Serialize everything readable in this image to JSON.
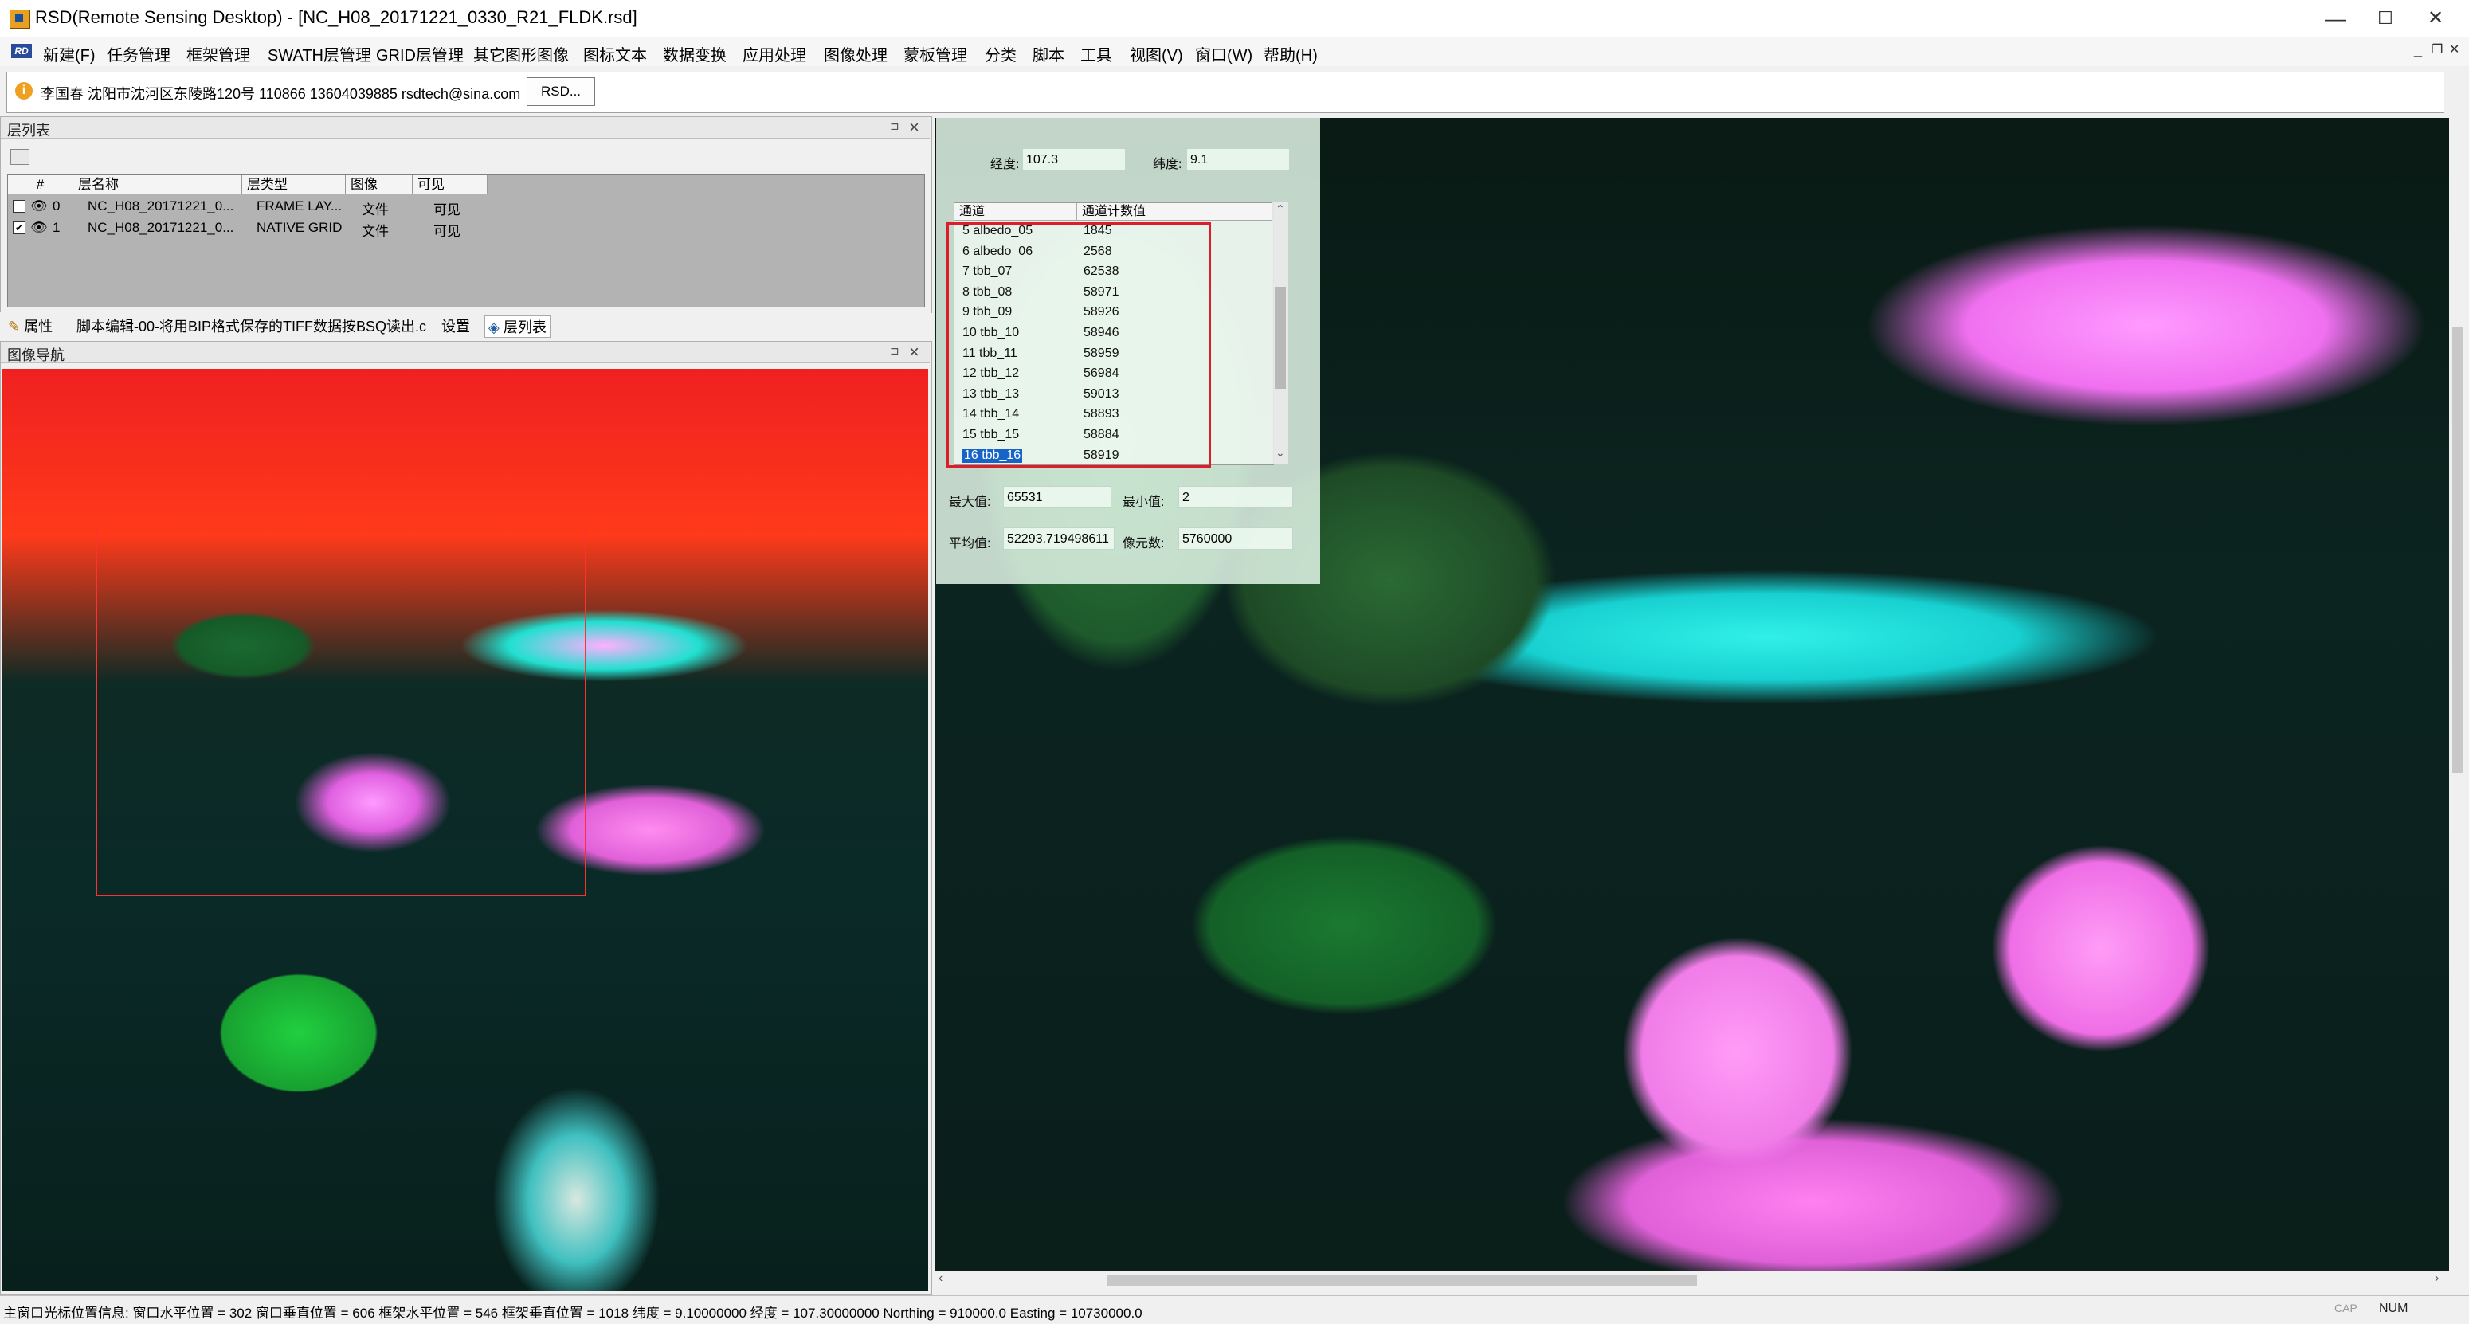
{
  "window": {
    "title": "RSD(Remote Sensing Desktop) - [NC_H08_20171221_0330_R21_FLDK.rsd]",
    "minimize": "—",
    "maximize": "☐",
    "close": "✕"
  },
  "menu": {
    "items": [
      "新建(F)",
      "任务管理",
      "框架管理",
      "SWATH层管理",
      "GRID层管理",
      "其它图形图像",
      "图标文本",
      "数据变换",
      "应用处理",
      "图像处理",
      "蒙板管理",
      "分类",
      "脚本",
      "工具",
      "视图(V)",
      "窗口(W)",
      "帮助(H)"
    ],
    "mdi_min": "_",
    "mdi_restore": "❐",
    "mdi_close": "✕"
  },
  "infobar": {
    "text": "李国春 沈阳市沈河区东陵路120号 110866 13604039885 rsdtech@sina.com",
    "button": "RSD..."
  },
  "layer_panel": {
    "title": "层列表",
    "columns": [
      "#",
      "层名称",
      "层类型",
      "图像",
      "可见"
    ],
    "rows": [
      {
        "checked": "",
        "index": "0",
        "name": "NC_H08_20171221_0...",
        "type": "FRAME LAY...",
        "image": "文件",
        "visible": "可见"
      },
      {
        "checked": "✔",
        "index": "1",
        "name": "NC_H08_20171221_0...",
        "type": "NATIVE GRID",
        "image": "文件",
        "visible": "可见"
      }
    ]
  },
  "panel_tabs": {
    "properties": "属性",
    "script": "脚本编辑-00-将用BIP格式保存的TIFF数据按BSQ读出.c",
    "settings": "设置",
    "layers": "层列表"
  },
  "nav_panel": {
    "title": "图像导航"
  },
  "channel_popup": {
    "lon_label": "经度:",
    "lon_value": "107.3",
    "lat_label": "纬度:",
    "lat_value": "9.1",
    "col_channel": "通道",
    "col_value": "通道计数值",
    "rows": [
      {
        "name": "5  albedo_05",
        "value": "1845"
      },
      {
        "name": "6  albedo_06",
        "value": "2568"
      },
      {
        "name": "7  tbb_07",
        "value": "62538"
      },
      {
        "name": "8  tbb_08",
        "value": "58971"
      },
      {
        "name": "9  tbb_09",
        "value": "58926"
      },
      {
        "name": "10  tbb_10",
        "value": "58946"
      },
      {
        "name": "11  tbb_11",
        "value": "58959"
      },
      {
        "name": "12  tbb_12",
        "value": "56984"
      },
      {
        "name": "13  tbb_13",
        "value": "59013"
      },
      {
        "name": "14  tbb_14",
        "value": "58893"
      },
      {
        "name": "15  tbb_15",
        "value": "58884"
      },
      {
        "name": "16  tbb_16",
        "value": "58919"
      }
    ],
    "selected_row": "16  tbb_16",
    "max_label": "最大值:",
    "max_value": "65531",
    "min_label": "最小值:",
    "min_value": "2",
    "mean_label": "平均值:",
    "mean_value": "52293.719498611",
    "pixels_label": "像元数:",
    "pixels_value": "5760000"
  },
  "status": {
    "text": "主窗口光标位置信息: 窗口水平位置 = 302 窗口垂直位置 = 606 框架水平位置 = 546 框架垂直位置 = 1018 纬度 = 9.10000000 经度 = 107.30000000 Northing = 910000.0 Easting = 10730000.0",
    "num": "NUM",
    "cap": "CAP"
  },
  "colors": {
    "highlight_box": "#dc1e2a",
    "selection": "#1764c8"
  }
}
